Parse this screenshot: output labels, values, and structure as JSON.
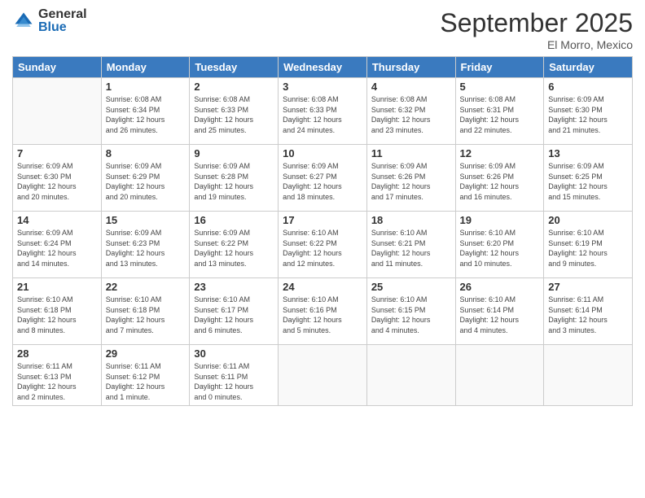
{
  "logo": {
    "general": "General",
    "blue": "Blue"
  },
  "title": "September 2025",
  "subtitle": "El Morro, Mexico",
  "days_header": [
    "Sunday",
    "Monday",
    "Tuesday",
    "Wednesday",
    "Thursday",
    "Friday",
    "Saturday"
  ],
  "weeks": [
    [
      {
        "num": "",
        "info": ""
      },
      {
        "num": "1",
        "info": "Sunrise: 6:08 AM\nSunset: 6:34 PM\nDaylight: 12 hours\nand 26 minutes."
      },
      {
        "num": "2",
        "info": "Sunrise: 6:08 AM\nSunset: 6:33 PM\nDaylight: 12 hours\nand 25 minutes."
      },
      {
        "num": "3",
        "info": "Sunrise: 6:08 AM\nSunset: 6:33 PM\nDaylight: 12 hours\nand 24 minutes."
      },
      {
        "num": "4",
        "info": "Sunrise: 6:08 AM\nSunset: 6:32 PM\nDaylight: 12 hours\nand 23 minutes."
      },
      {
        "num": "5",
        "info": "Sunrise: 6:08 AM\nSunset: 6:31 PM\nDaylight: 12 hours\nand 22 minutes."
      },
      {
        "num": "6",
        "info": "Sunrise: 6:09 AM\nSunset: 6:30 PM\nDaylight: 12 hours\nand 21 minutes."
      }
    ],
    [
      {
        "num": "7",
        "info": "Sunrise: 6:09 AM\nSunset: 6:30 PM\nDaylight: 12 hours\nand 20 minutes."
      },
      {
        "num": "8",
        "info": "Sunrise: 6:09 AM\nSunset: 6:29 PM\nDaylight: 12 hours\nand 20 minutes."
      },
      {
        "num": "9",
        "info": "Sunrise: 6:09 AM\nSunset: 6:28 PM\nDaylight: 12 hours\nand 19 minutes."
      },
      {
        "num": "10",
        "info": "Sunrise: 6:09 AM\nSunset: 6:27 PM\nDaylight: 12 hours\nand 18 minutes."
      },
      {
        "num": "11",
        "info": "Sunrise: 6:09 AM\nSunset: 6:26 PM\nDaylight: 12 hours\nand 17 minutes."
      },
      {
        "num": "12",
        "info": "Sunrise: 6:09 AM\nSunset: 6:26 PM\nDaylight: 12 hours\nand 16 minutes."
      },
      {
        "num": "13",
        "info": "Sunrise: 6:09 AM\nSunset: 6:25 PM\nDaylight: 12 hours\nand 15 minutes."
      }
    ],
    [
      {
        "num": "14",
        "info": "Sunrise: 6:09 AM\nSunset: 6:24 PM\nDaylight: 12 hours\nand 14 minutes."
      },
      {
        "num": "15",
        "info": "Sunrise: 6:09 AM\nSunset: 6:23 PM\nDaylight: 12 hours\nand 13 minutes."
      },
      {
        "num": "16",
        "info": "Sunrise: 6:09 AM\nSunset: 6:22 PM\nDaylight: 12 hours\nand 13 minutes."
      },
      {
        "num": "17",
        "info": "Sunrise: 6:10 AM\nSunset: 6:22 PM\nDaylight: 12 hours\nand 12 minutes."
      },
      {
        "num": "18",
        "info": "Sunrise: 6:10 AM\nSunset: 6:21 PM\nDaylight: 12 hours\nand 11 minutes."
      },
      {
        "num": "19",
        "info": "Sunrise: 6:10 AM\nSunset: 6:20 PM\nDaylight: 12 hours\nand 10 minutes."
      },
      {
        "num": "20",
        "info": "Sunrise: 6:10 AM\nSunset: 6:19 PM\nDaylight: 12 hours\nand 9 minutes."
      }
    ],
    [
      {
        "num": "21",
        "info": "Sunrise: 6:10 AM\nSunset: 6:18 PM\nDaylight: 12 hours\nand 8 minutes."
      },
      {
        "num": "22",
        "info": "Sunrise: 6:10 AM\nSunset: 6:18 PM\nDaylight: 12 hours\nand 7 minutes."
      },
      {
        "num": "23",
        "info": "Sunrise: 6:10 AM\nSunset: 6:17 PM\nDaylight: 12 hours\nand 6 minutes."
      },
      {
        "num": "24",
        "info": "Sunrise: 6:10 AM\nSunset: 6:16 PM\nDaylight: 12 hours\nand 5 minutes."
      },
      {
        "num": "25",
        "info": "Sunrise: 6:10 AM\nSunset: 6:15 PM\nDaylight: 12 hours\nand 4 minutes."
      },
      {
        "num": "26",
        "info": "Sunrise: 6:10 AM\nSunset: 6:14 PM\nDaylight: 12 hours\nand 4 minutes."
      },
      {
        "num": "27",
        "info": "Sunrise: 6:11 AM\nSunset: 6:14 PM\nDaylight: 12 hours\nand 3 minutes."
      }
    ],
    [
      {
        "num": "28",
        "info": "Sunrise: 6:11 AM\nSunset: 6:13 PM\nDaylight: 12 hours\nand 2 minutes."
      },
      {
        "num": "29",
        "info": "Sunrise: 6:11 AM\nSunset: 6:12 PM\nDaylight: 12 hours\nand 1 minute."
      },
      {
        "num": "30",
        "info": "Sunrise: 6:11 AM\nSunset: 6:11 PM\nDaylight: 12 hours\nand 0 minutes."
      },
      {
        "num": "",
        "info": ""
      },
      {
        "num": "",
        "info": ""
      },
      {
        "num": "",
        "info": ""
      },
      {
        "num": "",
        "info": ""
      }
    ]
  ]
}
